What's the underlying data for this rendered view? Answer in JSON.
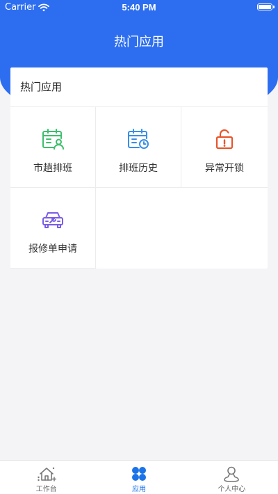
{
  "status_bar": {
    "carrier": "Carrier",
    "time": "5:40 PM"
  },
  "header": {
    "title": "热门应用"
  },
  "card": {
    "title": "热门应用",
    "apps": [
      {
        "label": "市趟排班",
        "icon": "calendar-user-icon",
        "color": "#3cbf6b"
      },
      {
        "label": "排班历史",
        "icon": "calendar-clock-icon",
        "color": "#3a8ee6"
      },
      {
        "label": "异常开锁",
        "icon": "unlock-icon",
        "color": "#e8542a"
      },
      {
        "label": "报修单申请",
        "icon": "car-repair-icon",
        "color": "#7a5ce6"
      }
    ]
  },
  "tabbar": {
    "items": [
      {
        "label": "工作台",
        "icon": "home-icon",
        "active": false
      },
      {
        "label": "应用",
        "icon": "apps-icon",
        "active": true
      },
      {
        "label": "个人中心",
        "icon": "person-icon",
        "active": false
      }
    ]
  },
  "colors": {
    "primary": "#2d6ef0",
    "tab_active": "#1a73e8"
  }
}
